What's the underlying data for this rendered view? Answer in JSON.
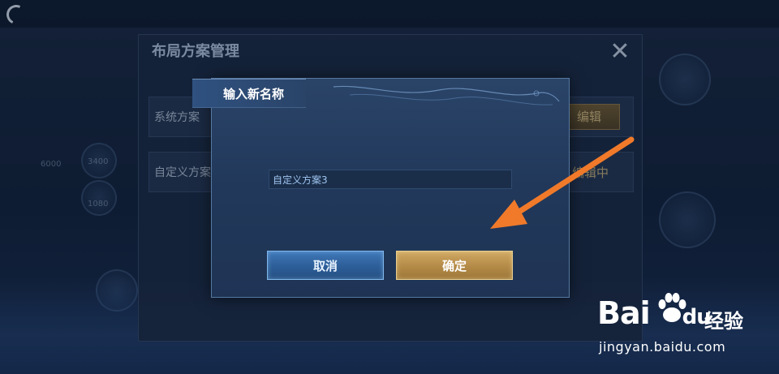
{
  "outer_panel": {
    "title": "布局方案管理",
    "rows": [
      {
        "label": "系统方案",
        "action_label": "编辑"
      },
      {
        "label": "自定义方案",
        "status_label": "编辑中"
      }
    ]
  },
  "hud": {
    "stat_1": "6000",
    "stat_2": "3400",
    "stat_3": "1080"
  },
  "dialog": {
    "title": "输入新名称",
    "input_value": "自定义方案3",
    "cancel_label": "取消",
    "confirm_label": "确定"
  },
  "annotation": {
    "arrow_color": "#f07a2a"
  },
  "watermark": {
    "brand": "Bai",
    "brand_suffix": "du",
    "chinese": "经验",
    "url": "jingyan.baidu.com"
  }
}
